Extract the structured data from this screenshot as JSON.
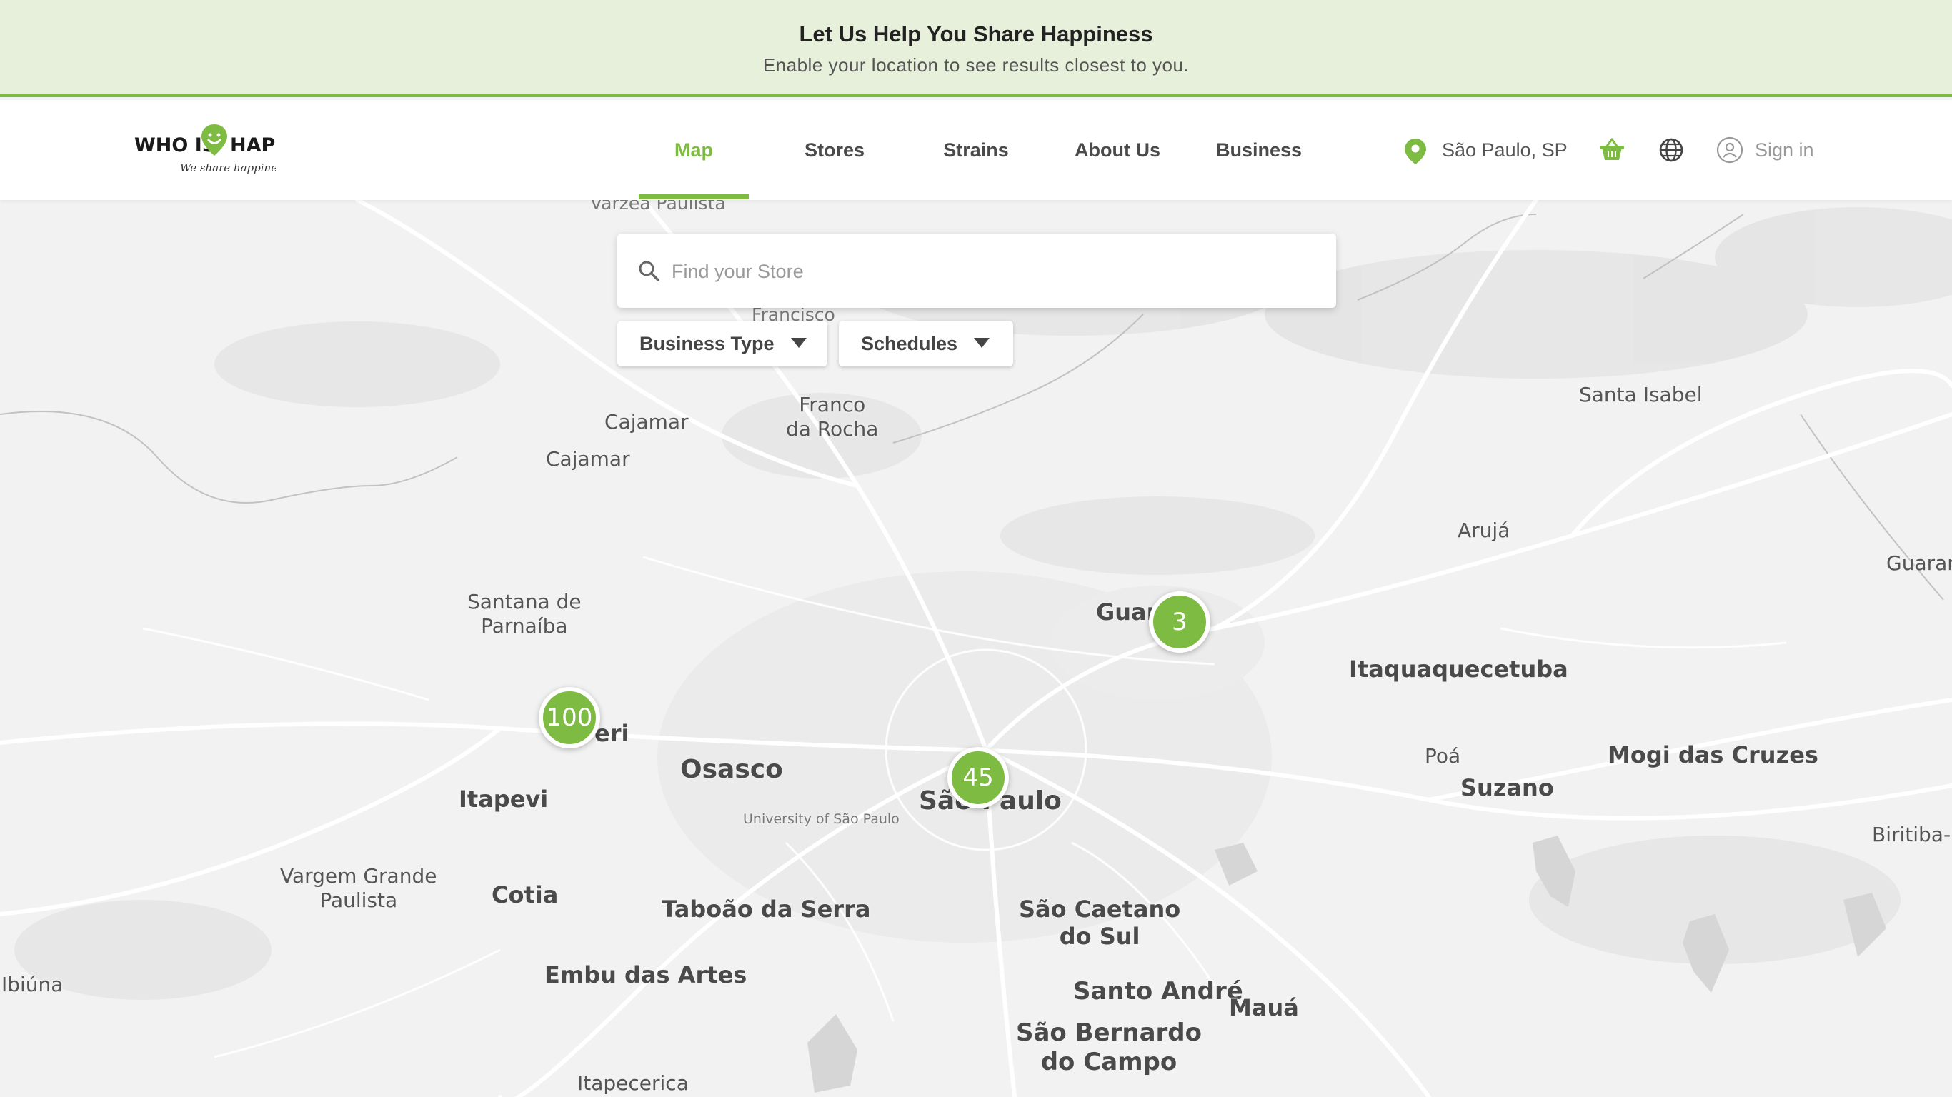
{
  "banner": {
    "title": "Let Us Help You Share Happiness",
    "subtitle": "Enable your location to see results closest to you."
  },
  "brand": {
    "logo_text": "WHO IS HAPPY",
    "tagline": "We share happiness !",
    "accent_color": "#7dbb42"
  },
  "nav": {
    "items": [
      {
        "label": "Map",
        "active": true
      },
      {
        "label": "Stores",
        "active": false
      },
      {
        "label": "Strains",
        "active": false
      },
      {
        "label": "About Us",
        "active": false
      },
      {
        "label": "Business",
        "active": false
      }
    ]
  },
  "header": {
    "location": "São Paulo, SP",
    "location_icon": "location-pin-icon",
    "cart_icon": "basket-icon",
    "language_icon": "globe-icon",
    "user_icon": "user-circle-icon",
    "signin_label": "Sign in"
  },
  "search": {
    "placeholder": "Find your Store",
    "value": "",
    "icon": "search-icon"
  },
  "filters": [
    {
      "label": "Business Type",
      "icon": "caret-down-icon"
    },
    {
      "label": "Schedules",
      "icon": "caret-down-icon"
    }
  ],
  "map": {
    "places": [
      {
        "name": "Várzea Paulista"
      },
      {
        "name": "Francisco"
      },
      {
        "name": "Cajamar"
      },
      {
        "name": "Franco\nda Rocha"
      },
      {
        "name": "Cajamar"
      },
      {
        "name": "Santa Isabel"
      },
      {
        "name": "Arujá"
      },
      {
        "name": "Guarar"
      },
      {
        "name": "Santana de\nParnaíba"
      },
      {
        "name": "Guar"
      },
      {
        "name": "Itaquaquecetuba"
      },
      {
        "name": "eri"
      },
      {
        "name": "Osasco"
      },
      {
        "name": "São Paulo"
      },
      {
        "name": "University of São Paulo"
      },
      {
        "name": "Poá"
      },
      {
        "name": "Mogi das Cruzes"
      },
      {
        "name": "Suzano"
      },
      {
        "name": "Itapevi"
      },
      {
        "name": "Vargem Grande\nPaulista"
      },
      {
        "name": "Cotia"
      },
      {
        "name": "Taboão da Serra"
      },
      {
        "name": "São Caetano\ndo Sul"
      },
      {
        "name": "Biritiba-M"
      },
      {
        "name": "Ibiúna"
      },
      {
        "name": "Embu das Artes"
      },
      {
        "name": "Santo André"
      },
      {
        "name": "Mauá"
      },
      {
        "name": "São Bernardo\ndo Campo"
      },
      {
        "name": "Itapecerica"
      }
    ],
    "clusters": [
      {
        "count": "3"
      },
      {
        "count": "100"
      },
      {
        "count": "45"
      }
    ]
  }
}
